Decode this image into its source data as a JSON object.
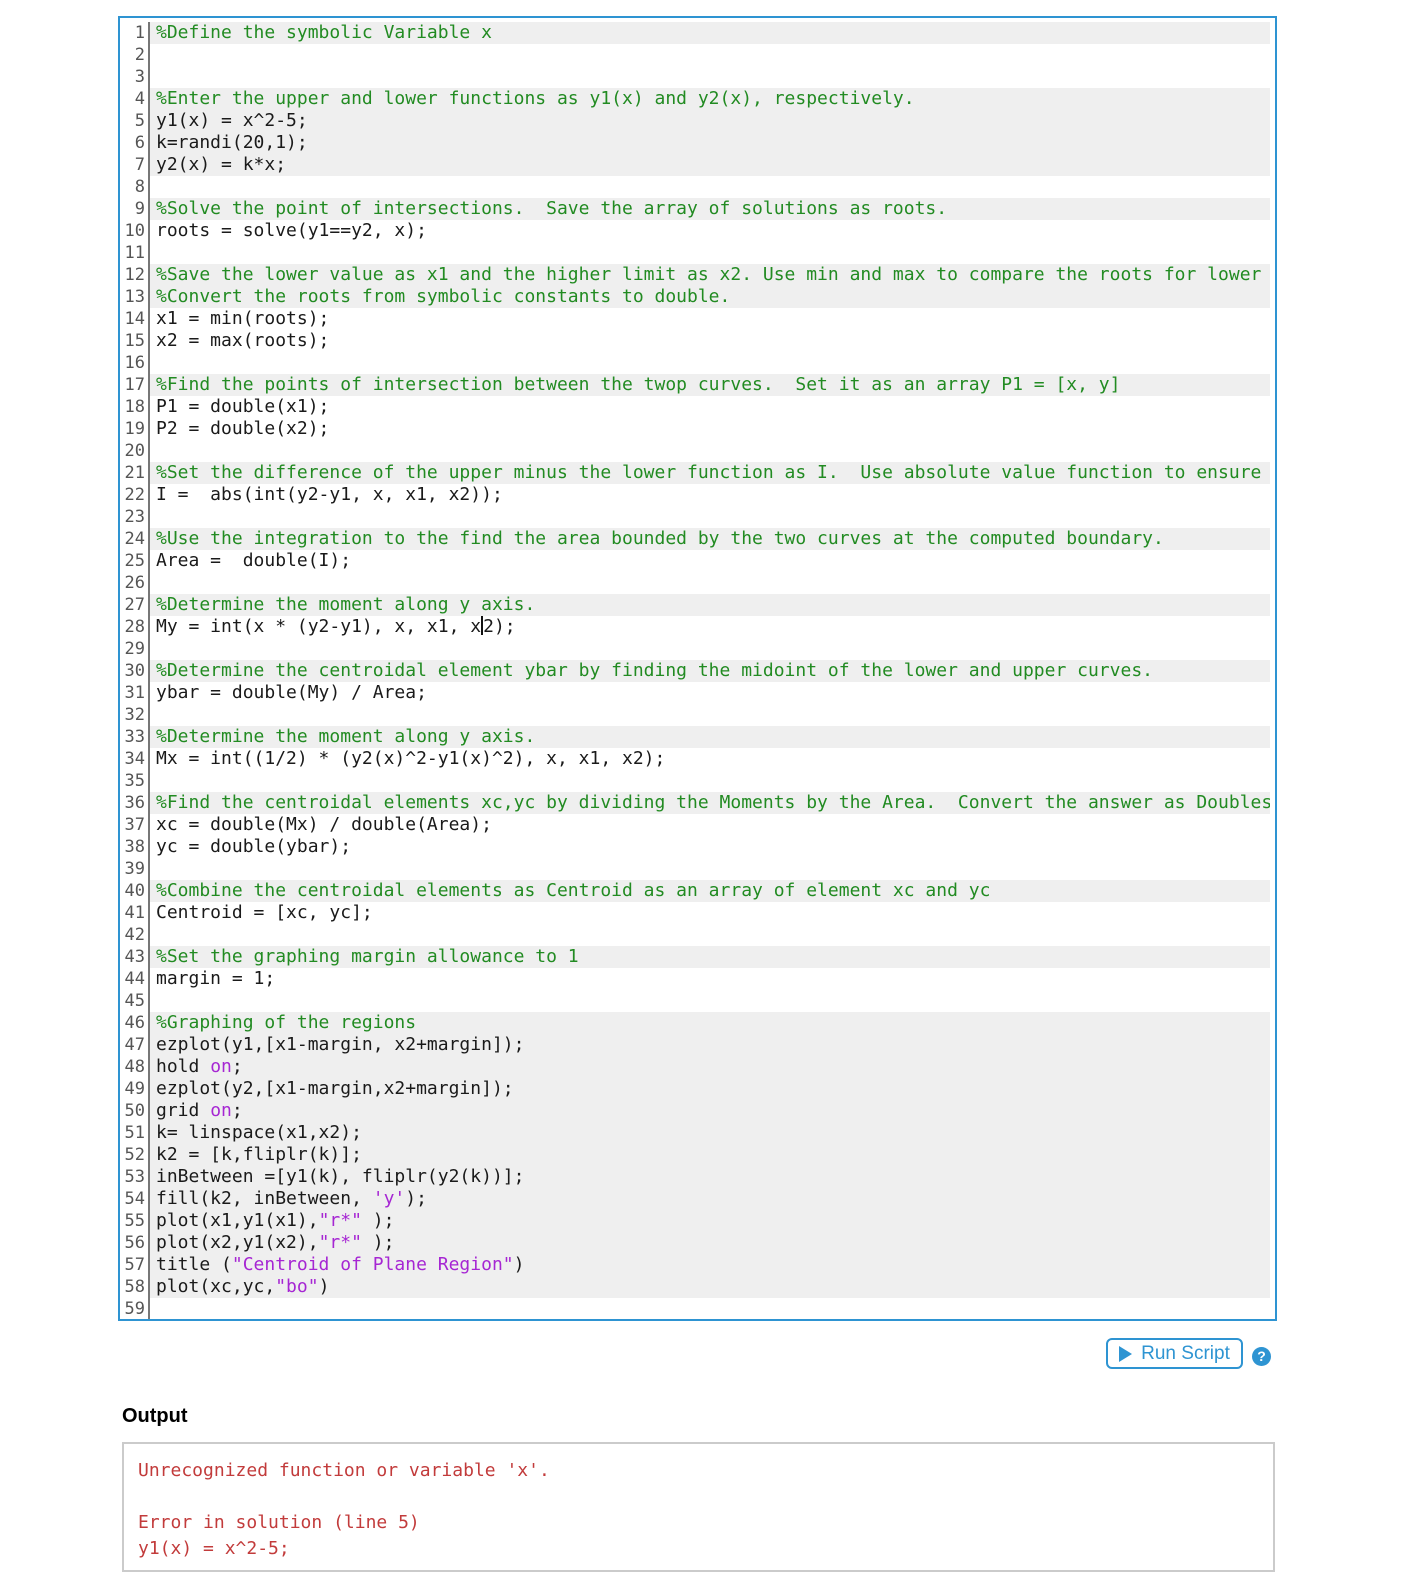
{
  "colors": {
    "accent": "#2e94d2",
    "comment": "#228b22",
    "code": "#1a1a1a",
    "string": "#a626d3",
    "hl": "#efefef",
    "error": "#c23b3b",
    "gutter-text": "#555555",
    "gutter-border": "#777777",
    "output-border": "#cbcbcb"
  },
  "editor": {
    "lines": [
      {
        "n": 1,
        "hl": true,
        "tokens": [
          [
            "comment",
            "%Define the symbolic Variable x"
          ]
        ]
      },
      {
        "n": 2,
        "hl": false,
        "tokens": []
      },
      {
        "n": 3,
        "hl": false,
        "tokens": []
      },
      {
        "n": 4,
        "hl": true,
        "tokens": [
          [
            "comment",
            "%Enter the upper and lower functions as y1(x) and y2(x), respectively."
          ]
        ]
      },
      {
        "n": 5,
        "hl": true,
        "tokens": [
          [
            "code",
            "y1(x) = x^2-5;"
          ]
        ]
      },
      {
        "n": 6,
        "hl": true,
        "tokens": [
          [
            "code",
            "k=randi(20,1);"
          ]
        ]
      },
      {
        "n": 7,
        "hl": true,
        "tokens": [
          [
            "code",
            "y2(x) = k*x;"
          ]
        ]
      },
      {
        "n": 8,
        "hl": false,
        "tokens": []
      },
      {
        "n": 9,
        "hl": true,
        "tokens": [
          [
            "comment",
            "%Solve the point of intersections.  Save the array of solutions as roots."
          ]
        ]
      },
      {
        "n": 10,
        "hl": false,
        "tokens": [
          [
            "code",
            "roots = solve(y1==y2, x);"
          ]
        ]
      },
      {
        "n": 11,
        "hl": false,
        "tokens": []
      },
      {
        "n": 12,
        "hl": true,
        "tokens": [
          [
            "comment",
            "%Save the lower value as x1 and the higher limit as x2. Use min and max to compare the roots for lower"
          ]
        ]
      },
      {
        "n": 13,
        "hl": true,
        "tokens": [
          [
            "comment",
            "%Convert the roots from symbolic constants to double."
          ]
        ]
      },
      {
        "n": 14,
        "hl": false,
        "tokens": [
          [
            "code",
            "x1 = min(roots);"
          ]
        ]
      },
      {
        "n": 15,
        "hl": false,
        "tokens": [
          [
            "code",
            "x2 = max(roots);"
          ]
        ]
      },
      {
        "n": 16,
        "hl": false,
        "tokens": []
      },
      {
        "n": 17,
        "hl": true,
        "tokens": [
          [
            "comment",
            "%Find the points of intersection between the twop curves.  Set it as an array P1 = [x, y]"
          ]
        ]
      },
      {
        "n": 18,
        "hl": false,
        "tokens": [
          [
            "code",
            "P1 = double(x1);"
          ]
        ]
      },
      {
        "n": 19,
        "hl": false,
        "tokens": [
          [
            "code",
            "P2 = double(x2);"
          ]
        ]
      },
      {
        "n": 20,
        "hl": false,
        "tokens": []
      },
      {
        "n": 21,
        "hl": true,
        "tokens": [
          [
            "comment",
            "%Set the difference of the upper minus the lower function as I.  Use absolute value function to ensure"
          ]
        ]
      },
      {
        "n": 22,
        "hl": false,
        "tokens": [
          [
            "code",
            "I =  abs(int(y2-y1, x, x1, x2));"
          ]
        ]
      },
      {
        "n": 23,
        "hl": false,
        "tokens": []
      },
      {
        "n": 24,
        "hl": true,
        "tokens": [
          [
            "comment",
            "%Use the integration to the find the area bounded by the two curves at the computed boundary."
          ]
        ]
      },
      {
        "n": 25,
        "hl": false,
        "tokens": [
          [
            "code",
            "Area =  double(I);"
          ]
        ]
      },
      {
        "n": 26,
        "hl": false,
        "tokens": []
      },
      {
        "n": 27,
        "hl": true,
        "tokens": [
          [
            "comment",
            "%Determine the moment along y axis."
          ]
        ]
      },
      {
        "n": 28,
        "hl": false,
        "tokens": [
          [
            "code",
            "My = int(x * (y2-y1), x, x1, x"
          ],
          [
            "caret",
            ""
          ],
          [
            "code",
            "2);"
          ]
        ]
      },
      {
        "n": 29,
        "hl": false,
        "tokens": []
      },
      {
        "n": 30,
        "hl": true,
        "tokens": [
          [
            "comment",
            "%Determine the centroidal element ybar by finding the midoint of the lower and upper curves."
          ]
        ]
      },
      {
        "n": 31,
        "hl": false,
        "tokens": [
          [
            "code",
            "ybar = double(My) / Area;"
          ]
        ]
      },
      {
        "n": 32,
        "hl": false,
        "tokens": []
      },
      {
        "n": 33,
        "hl": true,
        "tokens": [
          [
            "comment",
            "%Determine the moment along y axis."
          ]
        ]
      },
      {
        "n": 34,
        "hl": false,
        "tokens": [
          [
            "code",
            "Mx = int((1/2) * (y2(x)^2-y1(x)^2), x, x1, x2);"
          ]
        ]
      },
      {
        "n": 35,
        "hl": false,
        "tokens": []
      },
      {
        "n": 36,
        "hl": true,
        "tokens": [
          [
            "comment",
            "%Find the centroidal elements xc,yc by dividing the Moments by the Area.  Convert the answer as Doubles"
          ]
        ]
      },
      {
        "n": 37,
        "hl": false,
        "tokens": [
          [
            "code",
            "xc = double(Mx) / double(Area);"
          ]
        ]
      },
      {
        "n": 38,
        "hl": false,
        "tokens": [
          [
            "code",
            "yc = double(ybar);"
          ]
        ]
      },
      {
        "n": 39,
        "hl": false,
        "tokens": []
      },
      {
        "n": 40,
        "hl": true,
        "tokens": [
          [
            "comment",
            "%Combine the centroidal elements as Centroid as an array of element xc and yc"
          ]
        ]
      },
      {
        "n": 41,
        "hl": false,
        "tokens": [
          [
            "code",
            "Centroid = [xc, yc];"
          ]
        ]
      },
      {
        "n": 42,
        "hl": false,
        "tokens": []
      },
      {
        "n": 43,
        "hl": true,
        "tokens": [
          [
            "comment",
            "%Set the graphing margin allowance to 1"
          ]
        ]
      },
      {
        "n": 44,
        "hl": false,
        "tokens": [
          [
            "code",
            "margin = 1;"
          ]
        ]
      },
      {
        "n": 45,
        "hl": false,
        "tokens": []
      },
      {
        "n": 46,
        "hl": true,
        "tokens": [
          [
            "comment",
            "%Graphing of the regions"
          ]
        ]
      },
      {
        "n": 47,
        "hl": true,
        "tokens": [
          [
            "code",
            "ezplot(y1,[x1-margin, x2+margin]);"
          ]
        ]
      },
      {
        "n": 48,
        "hl": true,
        "tokens": [
          [
            "code",
            "hold "
          ],
          [
            "string",
            "on"
          ],
          [
            "code",
            ";"
          ]
        ]
      },
      {
        "n": 49,
        "hl": true,
        "tokens": [
          [
            "code",
            "ezplot(y2,[x1-margin,x2+margin]);"
          ]
        ]
      },
      {
        "n": 50,
        "hl": true,
        "tokens": [
          [
            "code",
            "grid "
          ],
          [
            "string",
            "on"
          ],
          [
            "code",
            ";"
          ]
        ]
      },
      {
        "n": 51,
        "hl": true,
        "tokens": [
          [
            "code",
            "k= linspace(x1,x2);"
          ]
        ]
      },
      {
        "n": 52,
        "hl": true,
        "tokens": [
          [
            "code",
            "k2 = [k,fliplr(k)];"
          ]
        ]
      },
      {
        "n": 53,
        "hl": true,
        "tokens": [
          [
            "code",
            "inBetween =[y1(k), fliplr(y2(k))];"
          ]
        ]
      },
      {
        "n": 54,
        "hl": true,
        "tokens": [
          [
            "code",
            "fill(k2, inBetween, "
          ],
          [
            "string",
            "'y'"
          ],
          [
            "code",
            ");"
          ]
        ]
      },
      {
        "n": 55,
        "hl": true,
        "tokens": [
          [
            "code",
            "plot(x1,y1(x1),"
          ],
          [
            "string",
            "\"r*\""
          ],
          [
            "code",
            " );"
          ]
        ]
      },
      {
        "n": 56,
        "hl": true,
        "tokens": [
          [
            "code",
            "plot(x2,y1(x2),"
          ],
          [
            "string",
            "\"r*\""
          ],
          [
            "code",
            " );"
          ]
        ]
      },
      {
        "n": 57,
        "hl": true,
        "tokens": [
          [
            "code",
            "title ("
          ],
          [
            "string",
            "\"Centroid of Plane Region\""
          ],
          [
            "code",
            ")"
          ]
        ]
      },
      {
        "n": 58,
        "hl": true,
        "tokens": [
          [
            "code",
            "plot(xc,yc,"
          ],
          [
            "string",
            "\"bo\""
          ],
          [
            "code",
            ")"
          ]
        ]
      },
      {
        "n": 59,
        "hl": false,
        "tokens": []
      }
    ]
  },
  "toolbar": {
    "run_button_label": "Run Script",
    "run_icon": "play-triangle",
    "help_glyph": "?",
    "help_icon": "question-mark-circle"
  },
  "output": {
    "heading": "Output",
    "lines": [
      "Unrecognized function or variable 'x'.",
      "",
      "Error in solution (line 5)",
      "y1(x) = x^2-5;"
    ]
  }
}
